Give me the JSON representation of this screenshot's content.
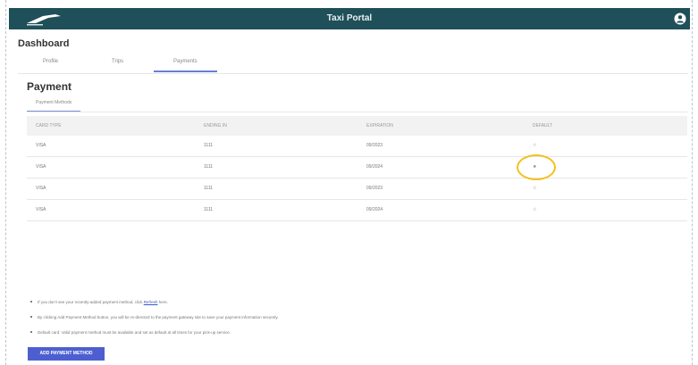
{
  "app": {
    "title": "Taxi Portal"
  },
  "dashboard": {
    "title": "Dashboard",
    "tabs": [
      {
        "label": "Profile",
        "active": false
      },
      {
        "label": "Trips",
        "active": false
      },
      {
        "label": "Payments",
        "active": true
      }
    ]
  },
  "payment": {
    "title": "Payment",
    "subtab": "Payment Methods",
    "columns": [
      "CARD TYPE",
      "ENDING IN",
      "EXPIRATION",
      "DEFAULT"
    ],
    "rows": [
      [
        "VISA",
        "1111",
        "09/2023",
        "☆"
      ],
      [
        "VISA",
        "1111",
        "09/2024",
        "★"
      ],
      [
        "VISA",
        "1111",
        "09/2023",
        "☆"
      ],
      [
        "VISA",
        "1111",
        "09/2024",
        "☆"
      ]
    ],
    "notes": {
      "n1_text": "If you don't see your recently-added payment method, click ",
      "n1_link": "Refresh",
      "n1_tail": " here.",
      "n2": "By clicking Add Payment Method button, you will be re-directed to the payment gateway site to save your payment information securely.",
      "n3": "Default card: Valid payment method must be available and set as default at all times for your pick-up service."
    },
    "add_button": "ADD PAYMENT METHOD"
  },
  "colors": {
    "header": "#1f4f59",
    "accent": "#4d5fd0",
    "highlight": "#f2c11d"
  }
}
